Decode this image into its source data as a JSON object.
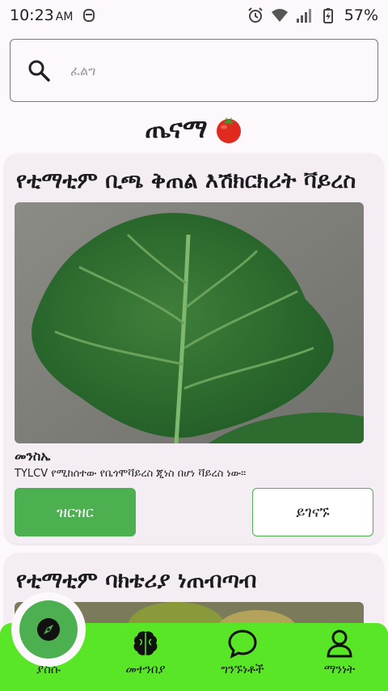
{
  "status_bar": {
    "time": "10:23",
    "ampm": "AM",
    "battery": "57%"
  },
  "search": {
    "placeholder": "ፈልግ"
  },
  "app": {
    "title": "ጤናማ"
  },
  "cards": [
    {
      "title": "የቲማቲም ቢጫ ቅጠል እሽክርክሪት ቫይረስ",
      "cause_label": "መንስኤ",
      "cause_text": "TYLCV የሚከሰተው የቤጎሞቫይረስ ጂነስ በሆነ ቫይረስ ነው።",
      "details_button": "ዝርዝር",
      "contact_button": "ይገናኙ"
    },
    {
      "title": "የቲማቲም ባክቴሪያ ነጠብጣብ"
    }
  ],
  "bottom_nav": {
    "items": [
      {
        "label": "ያስሱ",
        "icon": "compass-icon"
      },
      {
        "label": "መተንበያ",
        "icon": "brain-icon"
      },
      {
        "label": "ግንኙነቶች",
        "icon": "chat-bubble-icon"
      },
      {
        "label": "ማንነት",
        "icon": "person-icon"
      }
    ]
  },
  "colors": {
    "accent": "#4caf50",
    "nav_background": "#59e627",
    "background": "#fdf8fb",
    "card_background": "#f4eef4"
  }
}
